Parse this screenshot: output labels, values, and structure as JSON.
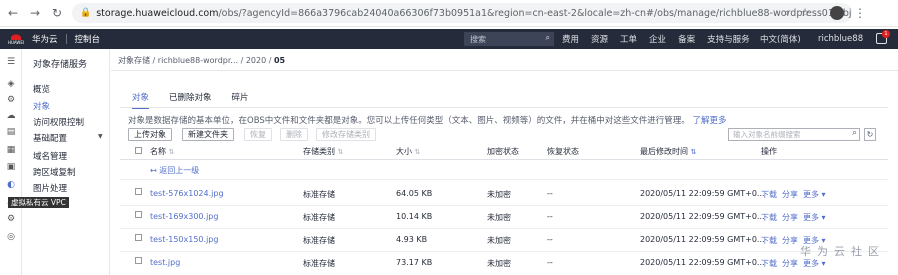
{
  "browser": {
    "url_host": "storage.huaweicloud.com",
    "url_path": "/obs/?agencyId=866a3796cab24040a66306f73b0951a1&region=cn-east-2&locale=zh-cn#/obs/manage/richblue88-wordpress01/obj..."
  },
  "topnav": {
    "brand": "华为云",
    "console": "控制台",
    "search": "搜索",
    "menu": [
      "费用",
      "资源",
      "工单",
      "企业",
      "备案",
      "支持与服务"
    ],
    "lang": "中文(简体)",
    "user": "richblue88",
    "badge": "1"
  },
  "sidebar": {
    "title": "对象存储服务",
    "items": [
      "概览",
      "对象",
      "访问权限控制",
      "基础配置",
      "域名管理",
      "跨区域复制",
      "图片处理"
    ],
    "tooltip": "虚拟私有云 VPC"
  },
  "breadcrumb": {
    "path": "对象存储 / richblue88-wordpr... / 2020 / ",
    "current": "05"
  },
  "tabs": [
    "对象",
    "已删除对象",
    "碎片"
  ],
  "description": {
    "text": "对象是数据存储的基本单位，在OBS中文件和文件夹都是对象。您可以上传任何类型（文本、图片、视频等）的文件，并在桶中对这些文件进行管理。",
    "link": "了解更多"
  },
  "toolbar": {
    "upload": "上传对象",
    "new_folder": "新建文件夹",
    "restore": "恢复",
    "delete": "删除",
    "change_class": "修改存储类别",
    "search_placeholder": "输入对象名前缀搜索"
  },
  "table": {
    "headers": [
      "名称",
      "存储类别",
      "大小",
      "加密状态",
      "恢复状态",
      "最后修改时间",
      "操作"
    ],
    "back_label": "返回上一级",
    "rows": [
      {
        "name": "test-576x1024.jpg",
        "class": "标准存储",
        "size": "64.05 KB",
        "encryption": "未加密",
        "restore": "--",
        "modified": "2020/05/11 22:09:59 GMT+0...",
        "download": "下载",
        "share": "分享",
        "more": "更多"
      },
      {
        "name": "test-169x300.jpg",
        "class": "标准存储",
        "size": "10.14 KB",
        "encryption": "未加密",
        "restore": "--",
        "modified": "2020/05/11 22:09:59 GMT+0...",
        "download": "下载",
        "share": "分享",
        "more": "更多"
      },
      {
        "name": "test-150x150.jpg",
        "class": "标准存储",
        "size": "4.93 KB",
        "encryption": "未加密",
        "restore": "--",
        "modified": "2020/05/11 22:09:59 GMT+0...",
        "download": "下载",
        "share": "分享",
        "more": "更多"
      },
      {
        "name": "test.jpg",
        "class": "标准存储",
        "size": "73.17 KB",
        "encryption": "未加密",
        "restore": "--",
        "modified": "2020/05/11 22:09:59 GMT+0...",
        "download": "下载",
        "share": "分享",
        "more": "更多"
      }
    ]
  },
  "watermark": "华为云社区"
}
